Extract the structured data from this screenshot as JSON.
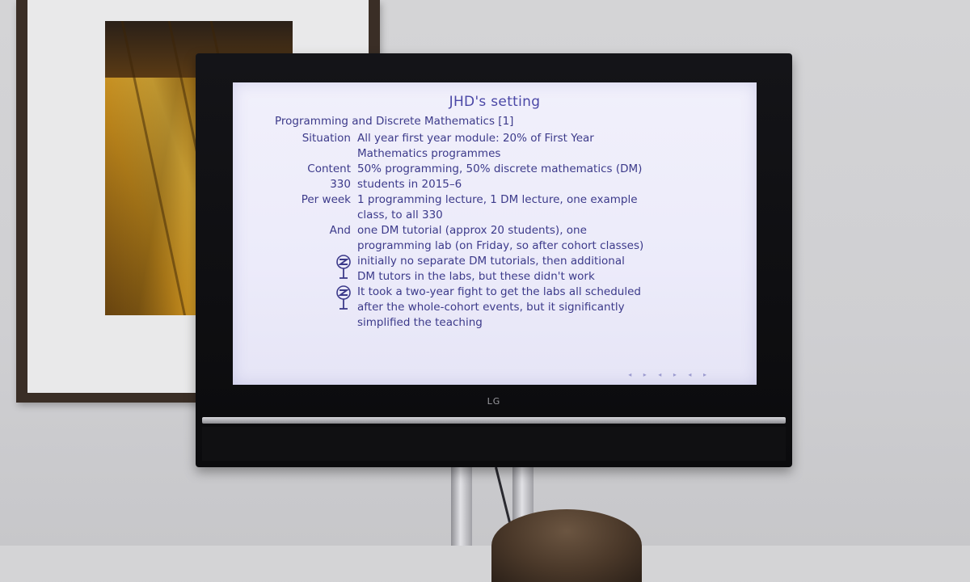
{
  "slide": {
    "title": "JHD's setting",
    "subtitle": "Programming and Discrete Mathematics [1]",
    "rows": [
      {
        "label": "Situation",
        "lines": [
          "All year first year module: 20% of First Year",
          "Mathematics programmes"
        ]
      },
      {
        "label": "Content",
        "lines": [
          "50% programming, 50% discrete mathematics (DM)"
        ]
      },
      {
        "label": "330",
        "lines": [
          "students in 2015–6"
        ]
      },
      {
        "label": "Per week",
        "lines": [
          "1 programming lecture, 1 DM lecture, one example",
          "class, to all 330"
        ]
      },
      {
        "label": "And",
        "lines": [
          "one DM tutorial (approx 20 students), one",
          "programming lab (on Friday, so after cohort classes)"
        ]
      }
    ],
    "warnings": [
      {
        "icon": "dangerous-bend-icon",
        "lines": [
          "initially no separate DM tutorials, then additional",
          "DM tutors in the labs, but these didn't work"
        ]
      },
      {
        "icon": "dangerous-bend-icon",
        "lines": [
          "It took a two-year fight to get the labs all scheduled",
          "after the whole-cohort events, but it significantly",
          "simplified the teaching"
        ]
      }
    ]
  },
  "tv": {
    "brand": "LG"
  },
  "colors": {
    "slide_text": "#3c3a8a",
    "slide_title": "#4a47a6",
    "screen_bg": "#ecebfa"
  }
}
